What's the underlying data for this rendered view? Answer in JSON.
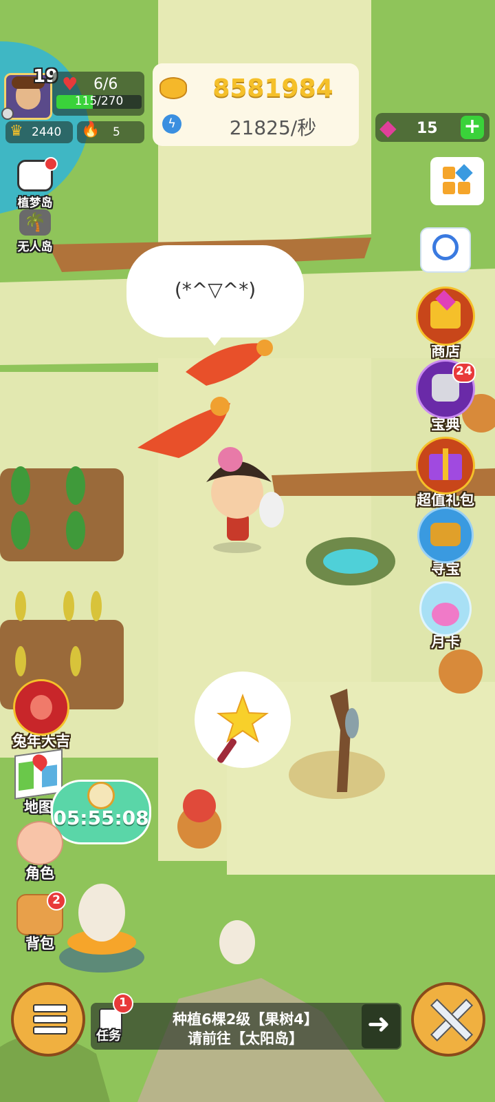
{
  "player": {
    "level": "19",
    "hp": "6/6",
    "exp": "115/270",
    "exp_fraction": 0.426,
    "crowns": "2440",
    "fire": "5"
  },
  "currency": {
    "gold": "8581984",
    "rate": "21825/秒",
    "gems": "15"
  },
  "islands": {
    "dream": "植梦岛",
    "desert": "无人岛"
  },
  "speech": "(*^▽^*)",
  "right_menu": {
    "service": "客服",
    "shop": "商店",
    "treasure_book": "宝典",
    "treasure_book_badge": "24",
    "gift": "超值礼包",
    "hunt": "寻宝",
    "month_card": "月卡"
  },
  "left_menu": {
    "rabbit": "兔年大吉",
    "map": "地图",
    "timer": "05:55:08",
    "role": "角色",
    "bag": "背包",
    "bag_badge": "2"
  },
  "bottom": {
    "menu": "菜单",
    "task_label": "任务",
    "task_badge": "1",
    "task_line1": "种植6棵2级【果树4】",
    "task_line2": "请前往【太阳岛】",
    "adventure": "冒险"
  },
  "colors": {
    "gold": "#f5c02a",
    "gem": "#e0409a",
    "green_bar": "#3ad23a",
    "grass": "#8fc45a",
    "path": "#e8ecb8"
  }
}
